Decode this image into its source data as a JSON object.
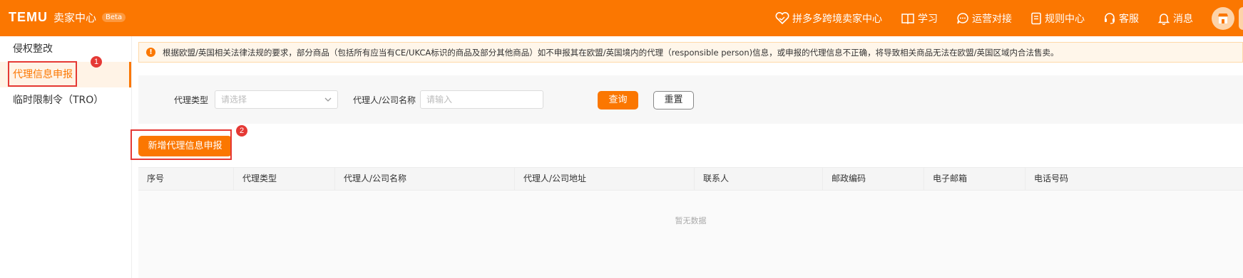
{
  "header": {
    "logo": "TEMU",
    "app_name": "卖家中心",
    "beta_badge": "Beta",
    "nav": [
      {
        "label": "拼多多跨境卖家中心",
        "icon": "heart-handshake-icon"
      },
      {
        "label": "学习",
        "icon": "book-icon"
      },
      {
        "label": "运营对接",
        "icon": "chat-icon"
      },
      {
        "label": "规则中心",
        "icon": "document-icon"
      },
      {
        "label": "客服",
        "icon": "headset-icon"
      },
      {
        "label": "消息",
        "icon": "bell-icon"
      }
    ]
  },
  "sidebar": {
    "items": [
      {
        "label": "侵权整改",
        "active": false
      },
      {
        "label": "代理信息申报",
        "active": true
      },
      {
        "label": "临时限制令（TRO）",
        "active": false
      }
    ]
  },
  "annotations": {
    "marker_1": "1",
    "marker_2": "2",
    "color": "#e53935"
  },
  "notice": {
    "text": "根据欧盟/英国相关法律法规的要求，部分商品（包括所有应当有CE/UKCA标识的商品及部分其他商品）如不申报其在欧盟/英国境内的代理（responsible person)信息，或申报的代理信息不正确，将导致相关商品无法在欧盟/英国区域内合法售卖。"
  },
  "filter": {
    "agent_type_label": "代理类型",
    "agent_type_placeholder": "请选择",
    "agent_name_label": "代理人/公司名称",
    "agent_name_placeholder": "请输入",
    "query_button": "查询",
    "reset_button": "重置"
  },
  "add_button": "新增代理信息申报",
  "table": {
    "columns": [
      "序号",
      "代理类型",
      "代理人/公司名称",
      "代理人/公司地址",
      "联系人",
      "邮政编码",
      "电子邮箱",
      "电话号码"
    ],
    "empty_text": "暂无数据"
  },
  "colors": {
    "brand_orange": "#fb7701",
    "annotation_red": "#e53935"
  }
}
